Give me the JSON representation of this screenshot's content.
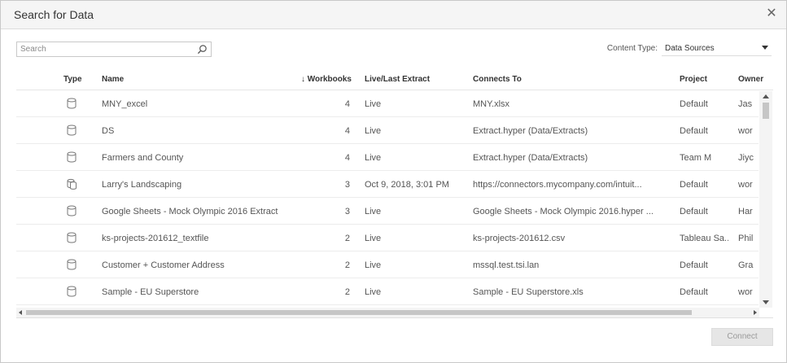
{
  "dialog": {
    "title": "Search for Data"
  },
  "search": {
    "placeholder": "Search"
  },
  "content_type": {
    "label": "Content Type:",
    "value": "Data Sources"
  },
  "table": {
    "headers": {
      "type": "Type",
      "name": "Name",
      "workbooks": "Workbooks",
      "sort_indicator": "↓",
      "live": "Live/Last Extract",
      "connects": "Connects To",
      "project": "Project",
      "owner": "Owner"
    },
    "rows": [
      {
        "icon": "cylinder-icon",
        "name": "MNY_excel",
        "workbooks": "4",
        "live": "Live",
        "connects": "MNY.xlsx",
        "project": "Default",
        "owner": "Jas"
      },
      {
        "icon": "cylinder-icon",
        "name": "DS",
        "workbooks": "4",
        "live": "Live",
        "connects": "Extract.hyper (Data/Extracts)",
        "project": "Default",
        "owner": "wor"
      },
      {
        "icon": "cylinder-icon",
        "name": "Farmers and County",
        "workbooks": "4",
        "live": "Live",
        "connects": "Extract.hyper (Data/Extracts)",
        "project": "Team M",
        "owner": "Jiyc"
      },
      {
        "icon": "cylinder-multi-icon",
        "name": "Larry's Landscaping",
        "workbooks": "3",
        "live": "Oct 9, 2018, 3:01 PM",
        "connects": "https://connectors.mycompany.com/intuit...",
        "project": "Default",
        "owner": "wor"
      },
      {
        "icon": "cylinder-icon",
        "name": "Google Sheets - Mock Olympic 2016 Extract",
        "workbooks": "3",
        "live": "Live",
        "connects": "Google Sheets - Mock Olympic 2016.hyper ...",
        "project": "Default",
        "owner": "Har"
      },
      {
        "icon": "cylinder-icon",
        "name": "ks-projects-201612_textfile",
        "workbooks": "2",
        "live": "Live",
        "connects": "ks-projects-201612.csv",
        "project": "Tableau Sa...",
        "owner": "Phil"
      },
      {
        "icon": "cylinder-icon",
        "name": "Customer + Customer Address",
        "workbooks": "2",
        "live": "Live",
        "connects": "mssql.test.tsi.lan",
        "project": "Default",
        "owner": "Gra"
      },
      {
        "icon": "cylinder-icon",
        "name": "Sample - EU Superstore",
        "workbooks": "2",
        "live": "Live",
        "connects": "Sample - EU Superstore.xls",
        "project": "Default",
        "owner": "wor"
      }
    ]
  },
  "footer": {
    "connect_label": "Connect"
  },
  "colors": {
    "title_bar": "#f5f5f5",
    "button_disabled": "#e6e6e6",
    "border": "#c8c8c8"
  }
}
